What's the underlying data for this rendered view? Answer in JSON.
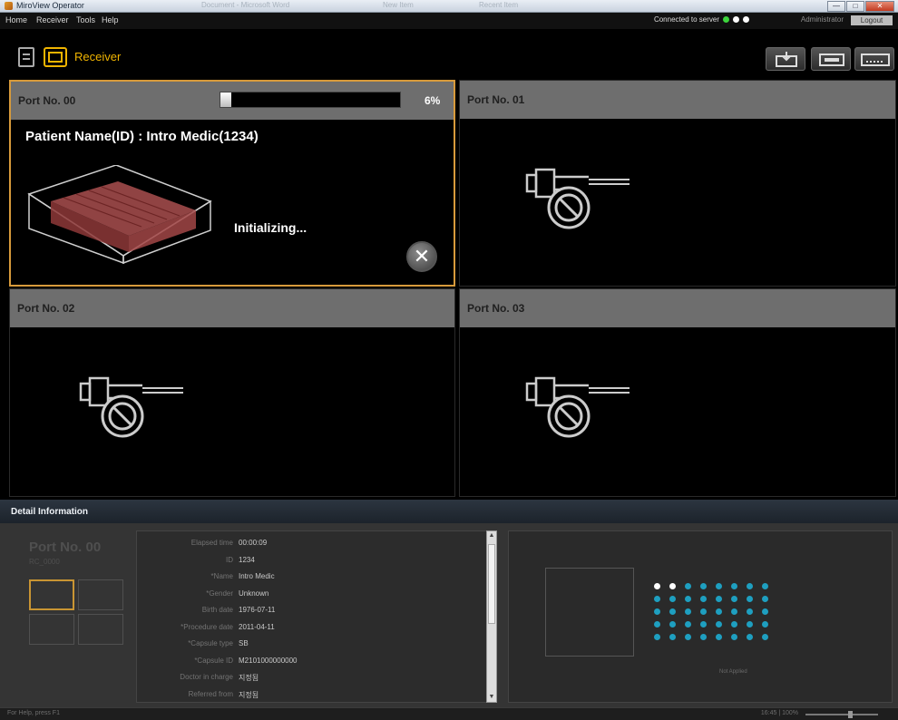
{
  "window": {
    "title": "MiroView Operator",
    "faded_tabs": [
      "Document - Microsoft Word",
      "New Item",
      "Recent Item"
    ],
    "controls": {
      "minimize": "—",
      "maximize": "□",
      "close": "✕"
    }
  },
  "menu": {
    "items": [
      "Home",
      "Receiver",
      "Tools",
      "Help"
    ],
    "connection_text": "Connected to server",
    "connection_dots": [
      "#3cd43c",
      "#ffffff",
      "#ffffff"
    ],
    "user": "Administrator",
    "logout_label": "Logout"
  },
  "toolbar": {
    "title": "Receiver",
    "buttons": [
      "receive-icon",
      "device-icon",
      "keyboard-icon"
    ]
  },
  "ports": [
    {
      "title": "Port No. 00",
      "state": "receiving",
      "progress_percent": 6,
      "progress_label": "6%",
      "patient_line": "Patient Name(ID) : Intro Medic(1234)",
      "status": "Initializing...",
      "cancel_label": "✕"
    },
    {
      "title": "Port No. 01",
      "state": "not-connected"
    },
    {
      "title": "Port No. 02",
      "state": "not-connected"
    },
    {
      "title": "Port No. 03",
      "state": "not-connected"
    }
  ],
  "detail": {
    "title": "Detail Information",
    "port_title": "Port No. 00",
    "port_sub": "RC_0000",
    "fields": [
      {
        "label": "Elapsed time",
        "value": "00:00:09"
      },
      {
        "label": "ID",
        "value": "1234"
      },
      {
        "label": "*Name",
        "value": "Intro Medic"
      },
      {
        "label": "*Gender",
        "value": "Unknown"
      },
      {
        "label": "Birth date",
        "value": "1976-07-11"
      },
      {
        "label": "*Procedure date",
        "value": "2011-04-11"
      },
      {
        "label": "*Capsule type",
        "value": "SB"
      },
      {
        "label": "*Capsule ID",
        "value": "M2101000000000"
      },
      {
        "label": "Doctor in charge",
        "value": "지정됨"
      },
      {
        "label": "Referred from",
        "value": "지정됨"
      }
    ],
    "dots_caption": "Not Applied",
    "dots": {
      "rows": 5,
      "cols": 8,
      "white_count": 2,
      "colors": {
        "active": "#1e9fc0",
        "highlight": "#ffffff"
      }
    }
  },
  "statusbar": {
    "left": "For Help, press F1",
    "right": "16:45 | 100%"
  },
  "colors": {
    "accent": "#f0b400",
    "active_border": "#d79a3b",
    "port_header": "#6e6e6e"
  }
}
